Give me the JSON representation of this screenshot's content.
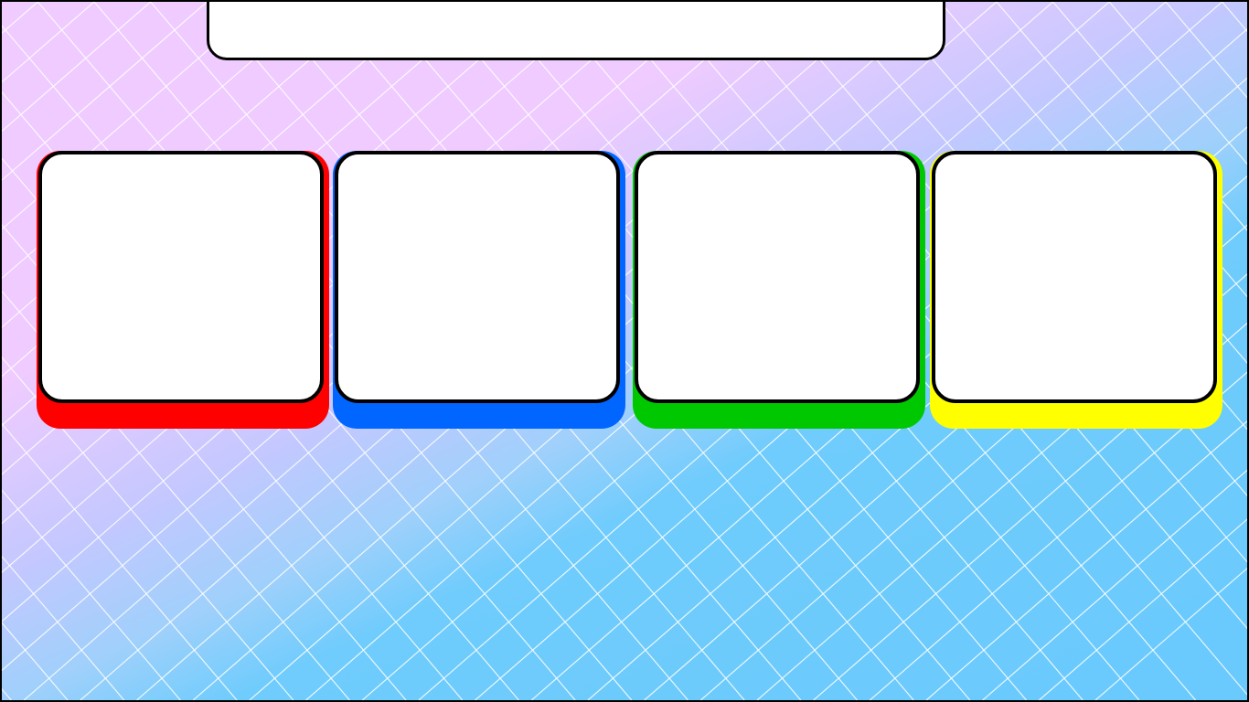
{
  "prompt": {
    "text": ""
  },
  "answers": [
    {
      "text": "",
      "color": "#ff0000"
    },
    {
      "text": "",
      "color": "#0066ff"
    },
    {
      "text": "",
      "color": "#00c800"
    },
    {
      "text": "",
      "color": "#ffff00"
    }
  ],
  "background": {
    "gradient_top_color": "#efcbff",
    "gradient_bottom_color": "#6ac9fd",
    "grid_line_color": "#ffffff"
  }
}
